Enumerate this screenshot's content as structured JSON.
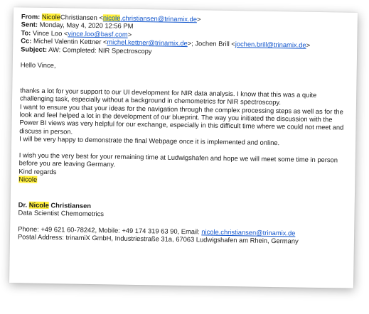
{
  "header": {
    "from_label": "From:",
    "from_first": "Nicole",
    "from_last": "Christiansen <",
    "from_email_hl": "nicole",
    "from_email_rest": ".christiansen@trinamix.de",
    "from_close": ">",
    "sent_label": "Sent:",
    "sent_value": "Monday, May 4, 2020 12:56 PM",
    "to_label": "To:",
    "to_name": "Vince Loo <",
    "to_email": "vince.loo@basf.com",
    "to_close": ">",
    "cc_label": "Cc:",
    "cc_name1": "Michel Valentin Kettner <",
    "cc_email1": "michel.kettner@trinamix.de",
    "cc_mid": ">; Jochen Brill <",
    "cc_email2": "jochen.brill@trinamix.de",
    "cc_close": ">",
    "subject_label": "Subject:",
    "subject_value": "AW: Completed: NIR Spectroscopy"
  },
  "body": {
    "greeting": "Hello Vince,",
    "p1": "thanks a lot for your support to our UI development for NIR data analysis. I know that this was a quite challenging task, especially without a background in chemometrics for NIR spectroscopy.",
    "p2": "I want to ensure you that your ideas for the navigation through the complex processing steps as well as for the look and feel helped a lot in the development of our blueprint. The way you initiated the discussion  with the Power BI views was very helpful for our exchange, especially in this difficult time where we could not meet and discuss in person.",
    "p3": "I will be very happy to demonstrate the final Webpage once it is implemented and online.",
    "p4": "I wish you the very best for your remaining time at Ludwigshafen and hope we will meet some time in person before you are leaving Germany.",
    "closing": "Kind regards",
    "signoff": "Nicole"
  },
  "signature": {
    "title": "Dr.",
    "first": "Nicole",
    "last": "Christiansen",
    "role": "Data Scientist Chemometrics",
    "phone_text": "Phone: +49 621 60-78242, Mobile: +49 174 319 63 90, Email:",
    "email": "nicole.christiansen@trinamix.de",
    "address": "Postal Address: trinamiX GmbH, Industriestraße 31a, 67063 Ludwigshafen am Rhein, Germany"
  },
  "colors": {
    "highlight": "#ffef3a",
    "link": "#1155cc",
    "text": "#1a1a1a"
  }
}
